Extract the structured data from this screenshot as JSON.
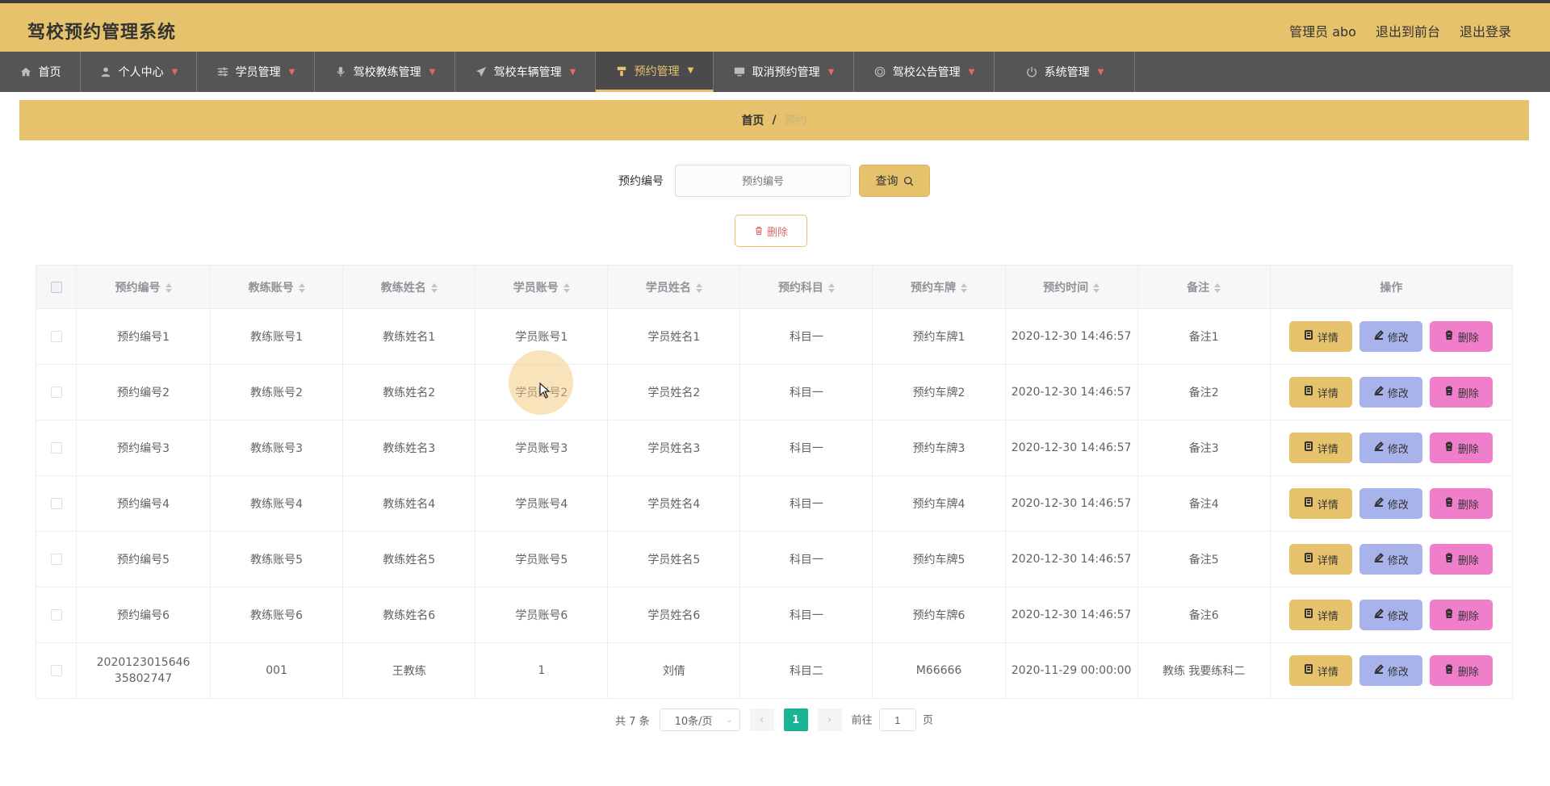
{
  "app": {
    "title": "驾校预约管理系统"
  },
  "header": {
    "user": "管理员 abo",
    "to_front": "退出到前台",
    "logout": "退出登录"
  },
  "nav": [
    {
      "label": "首页",
      "icon": "home-icon",
      "active": false
    },
    {
      "label": "个人中心",
      "icon": "user-icon",
      "active": false
    },
    {
      "label": "学员管理",
      "icon": "sliders-icon",
      "active": false
    },
    {
      "label": "驾校教练管理",
      "icon": "microphone-icon",
      "active": false
    },
    {
      "label": "驾校车辆管理",
      "icon": "send-icon",
      "active": false
    },
    {
      "label": "预约管理",
      "icon": "bookmark-icon",
      "active": true
    },
    {
      "label": "取消预约管理",
      "icon": "monitor-icon",
      "active": false
    },
    {
      "label": "驾校公告管理",
      "icon": "circle-icon",
      "active": false
    },
    {
      "label": "系统管理",
      "icon": "power-icon",
      "active": false
    }
  ],
  "breadcrumb": {
    "home": "首页",
    "sep": "/",
    "current": "预约"
  },
  "search": {
    "label": "预约编号",
    "placeholder": "预约编号",
    "button": "查询"
  },
  "toolbar": {
    "delete": "删除"
  },
  "table": {
    "headers": [
      "预约编号",
      "教练账号",
      "教练姓名",
      "学员账号",
      "学员姓名",
      "预约科目",
      "预约车牌",
      "预约时间",
      "备注",
      "操作"
    ],
    "rows": [
      [
        "预约编号1",
        "教练账号1",
        "教练姓名1",
        "学员账号1",
        "学员姓名1",
        "科目一",
        "预约车牌1",
        "2020-12-30 14:46:57",
        "备注1"
      ],
      [
        "预约编号2",
        "教练账号2",
        "教练姓名2",
        "学员账号2",
        "学员姓名2",
        "科目一",
        "预约车牌2",
        "2020-12-30 14:46:57",
        "备注2"
      ],
      [
        "预约编号3",
        "教练账号3",
        "教练姓名3",
        "学员账号3",
        "学员姓名3",
        "科目一",
        "预约车牌3",
        "2020-12-30 14:46:57",
        "备注3"
      ],
      [
        "预约编号4",
        "教练账号4",
        "教练姓名4",
        "学员账号4",
        "学员姓名4",
        "科目一",
        "预约车牌4",
        "2020-12-30 14:46:57",
        "备注4"
      ],
      [
        "预约编号5",
        "教练账号5",
        "教练姓名5",
        "学员账号5",
        "学员姓名5",
        "科目一",
        "预约车牌5",
        "2020-12-30 14:46:57",
        "备注5"
      ],
      [
        "预约编号6",
        "教练账号6",
        "教练姓名6",
        "学员账号6",
        "学员姓名6",
        "科目一",
        "预约车牌6",
        "2020-12-30 14:46:57",
        "备注6"
      ],
      [
        "202012301564635802747",
        "001",
        "王教练",
        "1",
        "刘倩",
        "科目二",
        "M66666",
        "2020-11-29 00:00:00",
        "教练 我要练科二"
      ]
    ],
    "ops": {
      "detail": "详情",
      "edit": "修改",
      "delete": "删除"
    }
  },
  "pager": {
    "total": "共 7 条",
    "page_size": "10条/页",
    "current_page": "1",
    "goto_label": "前往",
    "goto_value": "1",
    "page_unit": "页"
  }
}
